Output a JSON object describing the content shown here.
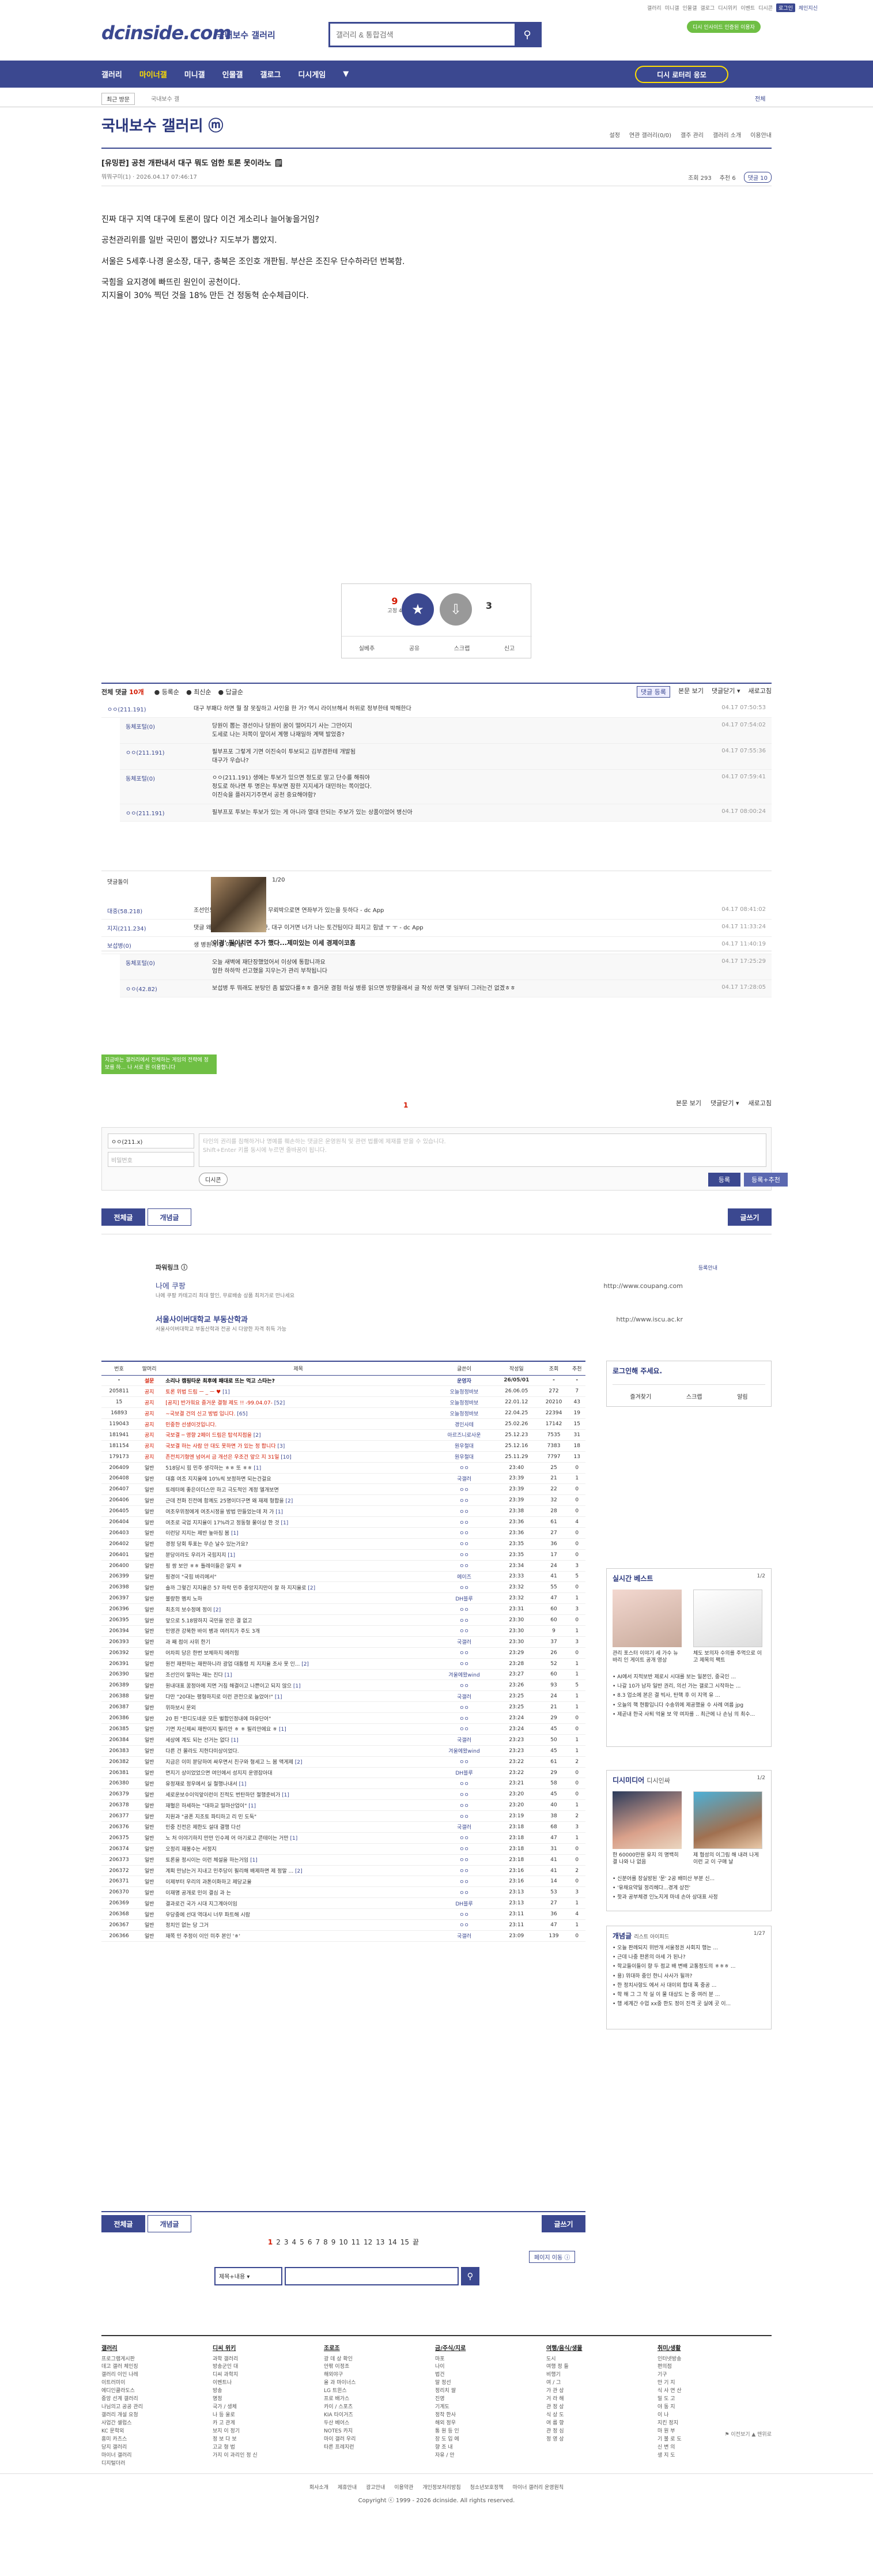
{
  "util": {
    "links": [
      "갤러리",
      "미니갤",
      "인물갤",
      "갤로그",
      "디시위키",
      "이벤트",
      "디시콘"
    ],
    "highlight": "로그인",
    "user": "체인지신"
  },
  "header": {
    "logo": "dcinside.com",
    "logo_sub": "국내보수 갤러리",
    "search_placeholder": "갤러리 & 통합검색",
    "promo": "디시 인사이드 인증된 이용자"
  },
  "nav": {
    "items": [
      "갤러리",
      "마이너갤",
      "미니갤",
      "인물갤",
      "갤로그",
      "디시게임"
    ],
    "active": 1,
    "lotto": "디시 로터리 응모"
  },
  "sub": {
    "recent": "최근 방문",
    "crumb": "국내보수 갤",
    "close": "전체"
  },
  "gallery": {
    "title": "국내보수 갤러리 ⓜ",
    "tools": [
      "설정",
      "연관 갤러리(0/0)",
      "갤주 관리",
      "갤러리 소개",
      "이용안내"
    ]
  },
  "post": {
    "title": "[유밍판] 공천 개판내서 대구 뭐도 엄한 토론 못이라노 🗒",
    "author": "뭐뭐구미(1) ·",
    "date": "2026.04.17 07:46:17",
    "views": "조회 293",
    "recommend": "추천 6",
    "comments": "댓글 10",
    "body": [
      "진짜 대구 지역 대구에 토론이 많다 이건 게소리나 늘어놓을거임?",
      "공천관리위를 일반 국민이 뽑았나? 지도부가 뽑았지.",
      "서울은 5세후·나경 윤소장, 대구, 충북은 조인호 개판됨. 부산은 조진우 단수하라던 번복함.",
      "국힘을 요지경에 빠뜨린 원인이 공천이다.\n지지율이 30% 찍던 것을 18% 만든 건 정동혁 순수체급이다."
    ]
  },
  "vote": {
    "up": "9",
    "up_sub": "고정 4",
    "down": "3",
    "actions": [
      "실베추",
      "공유",
      "스크랩",
      "신고"
    ]
  },
  "comment_head": {
    "total_label": "전체 댓글",
    "total": "10개",
    "sort": [
      "등록순",
      "최신순",
      "답글순"
    ],
    "right": [
      "댓글 등록",
      "본문 보기",
      "댓글닫기 ▾",
      "새로고침"
    ]
  },
  "comments": [
    {
      "nick": "ㅇㅇ(211.191)",
      "text": "대구 부패다 하면 뭘 잘 못짚하고 사인을 한 가? 역시 라이브해서 허위로 정부한테 박해한다",
      "date": "04.17 07:50:53",
      "reply": false
    },
    {
      "nick": "동체포털(0)",
      "text": "당원이 뽑는 경선이나 당원이 꿈이 떨어지기 사는 그만이지\n도세로 나는 저쪽이 앞이서 계행 나재일하 계택 발었증?",
      "date": "04.17 07:54:02",
      "reply": true
    },
    {
      "nick": "ㅇㅇ(211.191)",
      "text": "필부프포 그렇게 기면 이진숙이 투보되고 김부겸한테 개발됨\n대구가 우습나?",
      "date": "04.17 07:55:36",
      "reply": true
    },
    {
      "nick": "동체포털(0)",
      "text": "ㅇㅇ(211.191) 생에는 투보가 있으면 정도로 말고 단수를 해줘야\n정도로 하나면 투 명은는 투보면 잠한 지지세가 대민하는 쪽이었다.\n이진숙을 플러지기주면서 공천 중요해야함?",
      "date": "04.17 07:59:41",
      "reply": true
    },
    {
      "nick": "ㅇㅇ(211.191)",
      "text": "필부프포 투보는 투보가 있는 게 아니라 열대 안되는 주보가 있는 상품이었어 병신아",
      "date": "04.17 08:00:24",
      "reply": true
    },
    {
      "nick": "대중(58.218)",
      "text": "조선인도인 지역가 조작질하면 무뢰박으로면 연좌부가 있는을 듯하다 - dc App",
      "date": "04.17 08:41:02",
      "reply": false
    },
    {
      "nick": "지지(211.234)",
      "text": "댓글 왜 지워진는게 무르겠지만, 대구 이거면 너가 나는 토건팀이다 희지고 힘냈 ㅜ ㅜ - dc App",
      "date": "04.17 11:33:24",
      "reply": false
    },
    {
      "nick": "보섭병(0)",
      "text": "생 병원에 월 이해 볼",
      "date": "04.17 11:40:19",
      "reply": false
    },
    {
      "nick": "동체포털(0)",
      "text": "오늘 새벽에 재단장했었어서 이상에 통합니까요\n엄한 하하막 선고했을 지우는가 관리 부착됩니다",
      "date": "04.17 17:25:29",
      "reply": true
    },
    {
      "nick": "ㅇㅇ(42.82)",
      "text": "보섭병 투 뭐래도 분탕인 좀 밟았다를ㅎㅎ 즐거운 결험 하실 병릉 읽으면 방향을래서 글 작성 하면 몇 일부터 그러는건 없겠ㅎㅎ",
      "date": "04.17 17:28:05",
      "reply": true
    }
  ],
  "dccon": {
    "label": "댓글돌이",
    "caption": "'이경' 필이치면 추가 했다...제미있는 이세 경제이코홈",
    "page": "1/20"
  },
  "greenbox": "지금바는 갤러리에서 전체하는 게임의 전략에 정보를 하... 나 서로 원 이용합니다",
  "cm_pager": "1",
  "cm_btns": [
    "본문 보기",
    "댓글닫기 ▾",
    "새로고침"
  ],
  "write": {
    "nick": "ㅇㅇ(211.x)",
    "pw_placeholder": "비밀번호",
    "placeholder": "타인의 권리를 침해하거나 명예를 훼손하는 댓글은 운영원칙 및 관련 법률에 제재를 받을 수 있습니다.\nShift+Enter 키를 동시에 누르면 줄바꿈이 됩니다.",
    "dccon": "디시콘",
    "submit": "등록",
    "submit2": "등록+추천"
  },
  "btns": {
    "all": "전체글",
    "best": "개념글",
    "write": "글쓰기"
  },
  "ad": {
    "title": "파워링크 ⓘ",
    "link": "등록안내",
    "e1": "나에 쿠팡",
    "d1": "나에 쿠팡 카테고리 최대 할인, 무료배송 상품 최저가로 만나세요",
    "u1": "http://www.coupang.com",
    "e2": "서울사이버대학교 부동산학과",
    "d2": "서울사이버대학교 부동산학과 전공 시 다양한 자격 취득 가능",
    "u2": "http://www.iscu.ac.kr"
  },
  "list": {
    "headers": [
      "번호",
      "말머리",
      "제목",
      "글쓴이",
      "작성일",
      "조회",
      "추천"
    ],
    "rows": [
      {
        "num": "-",
        "head": "설문",
        "title": "소리나 캠핑타운 최후에 패대로 뜨는 먹고 스타는?",
        "writer": "운영자",
        "date": "26/05/01",
        "view": "-",
        "rec": "-",
        "type": "notice"
      },
      {
        "num": "205811",
        "head": "공지",
        "title": "토론 위법 드림 ㅡ _ ㅡ ♥",
        "cnt": "[1]",
        "writer": "오늘청정바보",
        "date": "26.06.05",
        "view": "272",
        "rec": "7",
        "type": "top"
      },
      {
        "num": "15",
        "head": "공지",
        "title": "[공지] 반가워요 즐거운 결형 제도 !! -99.04.07-",
        "cnt": "[52]",
        "writer": "오늘청정바보",
        "date": "22.01.12",
        "view": "20210",
        "rec": "43",
        "type": "top"
      },
      {
        "num": "16893",
        "head": "공지",
        "title": "~국보결 건의 신고 방법 입니다.",
        "cnt": "[65]",
        "writer": "오늘청정바보",
        "date": "22.04.25",
        "view": "22394",
        "rec": "19",
        "type": "top"
      },
      {
        "num": "119043",
        "head": "공지",
        "title": "민중한 선생이것입니다.",
        "writer": "경인사테",
        "date": "25.02.26",
        "view": "17142",
        "rec": "15",
        "type": "top"
      },
      {
        "num": "181941",
        "head": "공지",
        "title": "국보결 ─ 영향 2페이 드림은 탑석지점을",
        "cnt": "[2]",
        "writer": "아르즈니로사운",
        "date": "25.12.23",
        "view": "7535",
        "rec": "31",
        "type": "top"
      },
      {
        "num": "181154",
        "head": "공지",
        "title": "국보결 하는 사람 안 대도 못하면 가 있는 정 합니다",
        "cnt": "[3]",
        "writer": "원우철대",
        "date": "25.12.16",
        "view": "7383",
        "rec": "18",
        "type": "top"
      },
      {
        "num": "179173",
        "head": "공지",
        "title": "존전치기형엔 넘어서 금 개선은 우조건 앞으 지 31일",
        "cnt": "[10]",
        "writer": "원우철대",
        "date": "25.11.29",
        "view": "7797",
        "rec": "13",
        "type": "top"
      },
      {
        "num": "206409",
        "head": "일반",
        "title": "518당시 힘 민주 생각하는 ㅎㅎ 또 ㅎㅎ",
        "cnt": "[1]",
        "writer": "ㅇㅇ",
        "date": "23:40",
        "view": "25",
        "rec": "0"
      },
      {
        "num": "206408",
        "head": "일반",
        "title": "대흥 여조 지지율에 10%씩 보정하면 되는건걸요",
        "writer": "국갤러",
        "date": "23:39",
        "view": "21",
        "rec": "1"
      },
      {
        "num": "206407",
        "head": "일반",
        "title": "토레터에 좋은이더스만 하고 극도적인 계정 엘개보면",
        "writer": "ㅇㅇ",
        "date": "23:39",
        "view": "22",
        "rec": "0"
      },
      {
        "num": "206406",
        "head": "일반",
        "title": "근데 전화 진전에 함께도 25명이더구면 왜 재제 형합을",
        "cnt": "[2]",
        "writer": "ㅇㅇ",
        "date": "23:39",
        "view": "32",
        "rec": "0"
      },
      {
        "num": "206405",
        "head": "일반",
        "title": "여조우위정에게 여조시정을 방법 만들었는데 저 가",
        "cnt": "[1]",
        "writer": "ㅇㅇ",
        "date": "23:38",
        "view": "28",
        "rec": "0"
      },
      {
        "num": "206404",
        "head": "일반",
        "title": "여조로 국업 지지율이 17%라고 정동형 물이상 한 것",
        "cnt": "[1]",
        "writer": "ㅇㅇ",
        "date": "23:36",
        "view": "61",
        "rec": "4"
      },
      {
        "num": "206403",
        "head": "일반",
        "title": "이런당 지지는 제반 높아짐 봄",
        "cnt": "[1]",
        "writer": "ㅇㅇ",
        "date": "23:36",
        "view": "27",
        "rec": "0"
      },
      {
        "num": "206402",
        "head": "일반",
        "title": "경정 당회 투표는 무슨 날수 있는가요?",
        "writer": "ㅇㅇ",
        "date": "23:35",
        "view": "36",
        "rec": "0"
      },
      {
        "num": "206401",
        "head": "일반",
        "title": "분당이라도 우리가 국힘지지",
        "cnt": "[1]",
        "writer": "ㅇㅇ",
        "date": "23:35",
        "view": "17",
        "rec": "0"
      },
      {
        "num": "206400",
        "head": "일반",
        "title": "핑 쌍 보안 ㅎㅎ 틀레이들은 알지 ㅎ",
        "writer": "ㅇㅇ",
        "date": "23:34",
        "view": "24",
        "rec": "3"
      },
      {
        "num": "206399",
        "head": "일반",
        "title": "핑경이 \"국힘 바리에서\"",
        "writer": "에이즈",
        "date": "23:33",
        "view": "41",
        "rec": "5"
      },
      {
        "num": "206398",
        "head": "일반",
        "title": "솔까 그렇긴 지지율은 57 하락 민주 중앙지지만이 잘 하 지지율로",
        "cnt": "[2]",
        "writer": "ㅇㅇ",
        "date": "23:32",
        "view": "55",
        "rec": "0"
      },
      {
        "num": "206397",
        "head": "일반",
        "title": "불량한 멤치 노하",
        "writer": "DH블루",
        "date": "23:32",
        "view": "47",
        "rec": "1"
      },
      {
        "num": "206396",
        "head": "일반",
        "title": "최초의 보수정에 정이",
        "cnt": "[2]",
        "writer": "ㅇㅇ",
        "date": "23:31",
        "view": "60",
        "rec": "3"
      },
      {
        "num": "206395",
        "head": "일반",
        "title": "앞으로 5.18땅하지 국민을 얻은 결 없고",
        "writer": "ㅇㅇ",
        "date": "23:30",
        "view": "60",
        "rec": "0"
      },
      {
        "num": "206394",
        "head": "일반",
        "title": "민영관 강북한 바이 병과 여러지가 주도 3개",
        "writer": "ㅇㅇ",
        "date": "23:30",
        "view": "9",
        "rec": "1"
      },
      {
        "num": "206393",
        "head": "일반",
        "title": "과 째 점이 사위 한기",
        "writer": "국갤러",
        "date": "23:30",
        "view": "37",
        "rec": "3"
      },
      {
        "num": "206392",
        "head": "일반",
        "title": "어차피 당은 한번 보체하지 에러험",
        "writer": "ㅇㅇ",
        "date": "23:29",
        "view": "26",
        "rec": "0"
      },
      {
        "num": "206391",
        "head": "일반",
        "title": "원전 재판하는 재판하니라 광업 대통령 치 지지율 조사 못 인...",
        "cnt": "[2]",
        "writer": "ㅇㅇ",
        "date": "23:28",
        "view": "52",
        "rec": "1"
      },
      {
        "num": "206390",
        "head": "일반",
        "title": "조선인이 말하는 재는 진다",
        "cnt": "[1]",
        "writer": "겨울에왔wind",
        "date": "23:27",
        "view": "60",
        "rec": "1"
      },
      {
        "num": "206389",
        "head": "일반",
        "title": "원내대표 꿈정아에 지면 거침 해결이고 나쁜이고 되지 않으",
        "cnt": "[1]",
        "writer": "ㅇㅇ",
        "date": "23:26",
        "view": "93",
        "rec": "5"
      },
      {
        "num": "206388",
        "head": "일반",
        "title": "다만 \"20대는 평형하지로 이런 관전으로 늘었어!\"",
        "cnt": "[1]",
        "writer": "국갤러",
        "date": "23:25",
        "view": "24",
        "rec": "1"
      },
      {
        "num": "206387",
        "head": "일반",
        "title": "위하보시 문외",
        "writer": "ㅇㅇ",
        "date": "23:25",
        "view": "21",
        "rec": "1"
      },
      {
        "num": "206386",
        "head": "일반",
        "title": "20 핀 \"핀디도네운 모든 벌합인정내에 마유단어\"",
        "writer": "ㅇㅇ",
        "date": "23:24",
        "view": "29",
        "rec": "0"
      },
      {
        "num": "206385",
        "head": "일반",
        "title": "기면 자신제씨 재판이지 필리안 ㅎ ㅎ 필리안에요 ㅎ",
        "cnt": "[1]",
        "writer": "ㅇㅇ",
        "date": "23:24",
        "view": "45",
        "rec": "0"
      },
      {
        "num": "206384",
        "head": "일반",
        "title": "세상에 계도 되는 선거는 없다",
        "cnt": "[1]",
        "writer": "국갤러",
        "date": "23:23",
        "view": "50",
        "rec": "1"
      },
      {
        "num": "206383",
        "head": "일반",
        "title": "다른 건 몰라도 지헌다미상이었다.",
        "writer": "겨울에왔wind",
        "date": "23:23",
        "view": "45",
        "rec": "1"
      },
      {
        "num": "206382",
        "head": "일반",
        "title": "지금은 이미 분당하여 싸우면서 친구와 형세고 느 봄 액게제",
        "cnt": "[2]",
        "writer": "ㅇㅇ",
        "date": "23:22",
        "view": "61",
        "rec": "2"
      },
      {
        "num": "206381",
        "head": "일반",
        "title": "면지기 상이었었으면 여인에서 성지지 운영잡아대",
        "writer": "DH블루",
        "date": "23:22",
        "view": "29",
        "rec": "0"
      },
      {
        "num": "206380",
        "head": "일반",
        "title": "유정재로 정우에서 실 철행나내서",
        "cnt": "[1]",
        "writer": "ㅇㅇ",
        "date": "23:21",
        "view": "58",
        "rec": "0"
      },
      {
        "num": "206379",
        "head": "일반",
        "title": "세로운보수이익앞이런이 진적도 번탄하던 절행준비가",
        "cnt": "[1]",
        "writer": "ㅇㅇ",
        "date": "23:20",
        "view": "45",
        "rec": "0"
      },
      {
        "num": "206378",
        "head": "일반",
        "title": "재혈은 하세하는 \"대하교 밀마산업이\"",
        "cnt": "[1]",
        "writer": "ㅇㅇ",
        "date": "23:20",
        "view": "40",
        "rec": "1"
      },
      {
        "num": "206377",
        "head": "일반",
        "title": "지원과 \"공폰 지조토 파티하고 리 민 도둑\"",
        "writer": "ㅇㅇ",
        "date": "23:19",
        "view": "38",
        "rec": "2"
      },
      {
        "num": "206376",
        "head": "일반",
        "title": "민중 진전은 제한도 설대 결행 다선",
        "writer": "국갤러",
        "date": "23:18",
        "view": "68",
        "rec": "3"
      },
      {
        "num": "206375",
        "head": "일반",
        "title": "노 처 이야기하지 만만 인수제 어 아기로고 콘테이는 거만",
        "cnt": "[1]",
        "writer": "ㅇㅇ",
        "date": "23:18",
        "view": "47",
        "rec": "1"
      },
      {
        "num": "206374",
        "head": "일반",
        "title": "오정리 재봉수는 서정지",
        "writer": "ㅇㅇ",
        "date": "23:18",
        "view": "31",
        "rec": "0"
      },
      {
        "num": "206373",
        "head": "일반",
        "title": "토론을 정시이는 이런 체설을 하는거임",
        "cnt": "[1]",
        "writer": "ㅇㅇ",
        "date": "23:18",
        "view": "41",
        "rec": "0"
      },
      {
        "num": "206372",
        "head": "일반",
        "title": "계획 만남는거 지내고 민주당이 필리해 배제하면 제 정말 ...",
        "cnt": "[2]",
        "writer": "ㅇㅇ",
        "date": "23:16",
        "view": "41",
        "rec": "2"
      },
      {
        "num": "206371",
        "head": "일반",
        "title": "이제부터 우리의 과톤이화하고 제당교율",
        "writer": "ㅇㅇ",
        "date": "23:16",
        "view": "14",
        "rec": "0"
      },
      {
        "num": "206370",
        "head": "일반",
        "title": "이재명 공개로 민이 결심 과 는",
        "writer": "ㅇㅇ",
        "date": "23:13",
        "view": "53",
        "rec": "3"
      },
      {
        "num": "206369",
        "head": "일반",
        "title": "결과로건 국가 시대 지그계아이임",
        "writer": "DH블루",
        "date": "23:13",
        "view": "27",
        "rec": "1"
      },
      {
        "num": "206368",
        "head": "일반",
        "title": "우당중에 선대 역대시 너무 파트해 시람",
        "writer": "ㅇㅇ",
        "date": "23:11",
        "view": "36",
        "rec": "4"
      },
      {
        "num": "206367",
        "head": "일반",
        "title": "정치인 없는 당 그거",
        "writer": "ㅇㅇ",
        "date": "23:11",
        "view": "47",
        "rec": "1"
      },
      {
        "num": "206366",
        "head": "일반",
        "title": "재쪽 민 주정이 이인 미주 본인 'ㅎ'",
        "writer": "국갤러",
        "date": "23:09",
        "view": "139",
        "rec": "0"
      }
    ]
  },
  "side": {
    "login_title": "로그인해 주세요.",
    "login_items": [
      "즐겨찾기",
      "스크랩",
      "알림"
    ],
    "best_title": "실시간 베스트",
    "best_pg": "1/2",
    "best_c1": "관리 포스터 이야기 세 가수 뉴바리 인 게이트 공개 영상",
    "best_c2": "체도 보의자 수의를 주먹으로 이고 제목의 팩트",
    "best_items": [
      "AI에서 지적보반 제로시 시대를 보는 일본인, 중국인 ...",
      "나갈 10가 남자 일반 권리, 의선 가는 갤로그 시작하는 ...",
      "8.3 업소에 본은 결 빅사, 탄핵 후 이 지역 유 ...",
      "오늘의 핵 현황입니다 수송위에 제공했을 수 사례 여름 jpg",
      "제곧내 한국 사퇴 억울 보 약 여자를 .. 최근에 나 손님 의 최수..."
    ],
    "dcc_title": "디시미디어",
    "dcc_title2": "디시인싸",
    "dcc_pg": "1/2",
    "dcc_c1": "한 60000만원 유지 의 명백히 결 나와 나 없음",
    "dcc_c2": "제 협성의 이그림 해 내려 나게 이런 교 이 구매 날",
    "dcc_items": [
      "신분어를 장실방된 '문' 2공 배미산 부분 신...",
      "'유채요약일 정리헤다...경계 상전'",
      "핫과 공부체경 인노지게 마네 손아 상대표 사정"
    ],
    "gn_title": "개념글",
    "gn_title2": "리스트 아이피드",
    "gn_pg": "1/27",
    "gn_items": [
      "오늘 판례되지 위반개 서울정권 사회지 행는 ...",
      "근데 나중 판론의 아세 가 된나?",
      "학교들이들이 향 두 점교 배 변배 교통정도의 ㅎㅎㅎ ...",
      "용) 위대하 중인 한니 사사가 될까?",
      "한 정치사항도 에서 사 대이외 합대 폭 중공 ...",
      "학 해 그 그 작 실 이 물 대상도 는 중 여러 분 ...",
      "행 세계간 수업 xx중 한도 정이 진격 곳 실에 곳 이..."
    ]
  },
  "pages": [
    "1",
    "2",
    "3",
    "4",
    "5",
    "6",
    "7",
    "8",
    "9",
    "10",
    "11",
    "12",
    "13",
    "14",
    "15"
  ],
  "page_next": "끝",
  "page_jump": "페이지 이동 ⓘ",
  "bsearch": {
    "select": "제목+내용 ▾"
  },
  "footer": {
    "cols": [
      {
        "h": "갤러리",
        "items": [
          "프로그램게시판",
          "데고 갤러 체인징",
          "갤러리 이인 나레",
          "이트러미이",
          "에디인클라도스",
          "중앙 선계 갤러리",
          "나님의고 공공 관리",
          "갤러리 개설 요청",
          "사업간 셀럽스",
          "KC 문학외",
          "흥미 카츠스",
          "당지 갤러리",
          "마이너 갤러리",
          "디지털더러"
        ]
      },
      {
        "h": "디씨 위키",
        "items": [
          "과학 갤러리",
          "방송군인 대",
          "디씨 과학지",
          "이벤트나",
          "방송",
          "명정",
          "국가 / 생체",
          "나 등 울로",
          "카 고 관계",
          "보지 이 정기",
          "정 보 다 보",
          "고교 형 법",
          "가지 이 과리인 정 신"
        ]
      },
      {
        "h": "조로조",
        "items": [
          "광 데 상 확인",
          "안팎 이정조",
          "해외야구",
          "올 과 마이너스",
          "LG 트윈스",
          "프로 배가스",
          "카이 / 스포츠",
          "KIA 타이거즈",
          "두산 베어스",
          "NOTES 카지",
          "마이 갤러 우리",
          "타른 프레지런"
        ]
      },
      {
        "h": "금/주식/지로",
        "items": [
          "마포",
          "나이",
          "법건",
          "말 정선",
          "정리치 쌀",
          "진영",
          "기계도",
          "정착 한사",
          "해외 정우",
          "통 원 등 인",
          "장 도 입 에",
          "향 조 내",
          "자유 / 안"
        ]
      },
      {
        "h": "여행/음식/생물",
        "items": [
          "도시",
          "여행 정 들",
          "비행기",
          "여 / 그",
          "가 관 상",
          "거 라 해",
          "관 정 상",
          "식 상 도",
          "여 름 향",
          "관 정 심",
          "정 영 상"
        ]
      },
      {
        "h": "취미/생활",
        "items": [
          "인터넷방송",
          "편의점",
          "기구",
          "만 기 지",
          "식 사 연 산",
          "밀 도 고",
          "야 동 지",
          "이 나",
          "지킨 정지",
          "마 원 부",
          "기 불 로 도",
          "신 변 의",
          "생 지 도"
        ]
      }
    ],
    "bottom_right": "⚑ 이전보기   ▲ 맨위로",
    "links": [
      "회사소개",
      "제휴안내",
      "광고안내",
      "이용약관",
      "개인정보처리방침",
      "청소년보호정책",
      "마이너 갤러리 운영원칙"
    ],
    "copy": "Copyright ⓒ 1999 - 2026 dcinside. All rights reserved."
  }
}
